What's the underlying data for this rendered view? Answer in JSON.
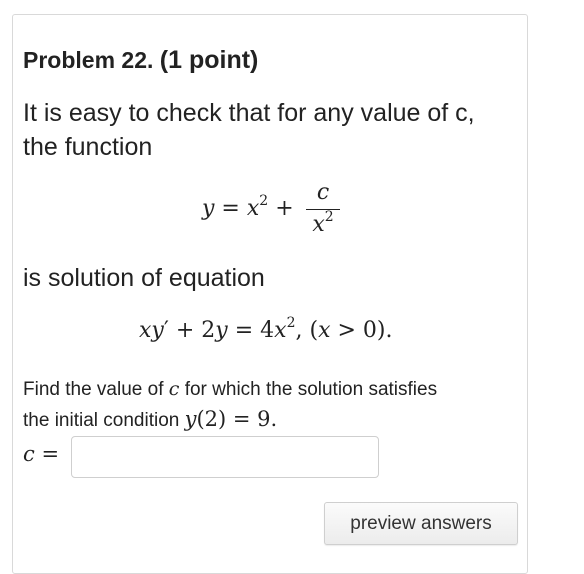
{
  "problem": {
    "label": "Problem 22.",
    "points": "(1 point)"
  },
  "intro": {
    "line1": "It is easy to check that for any value of c,",
    "line2": "the function"
  },
  "equation1": {
    "lhs": "y",
    "eq": " = ",
    "x": "x",
    "exp": "2",
    "plus": " +",
    "num": "c",
    "den_x": "x",
    "den_exp": "2"
  },
  "solution_text": "is solution of equation",
  "equation2": {
    "part1": "x",
    "part2": "y",
    "prime": "′",
    "part3": " + 2",
    "part4": "y",
    "part5": " = 4",
    "part6": "x",
    "exp": "2",
    "part7": ",  (",
    "part8": "x",
    "part9": " > 0)."
  },
  "question": {
    "line1_pre": "Find the value of ",
    "line1_var": "c",
    "line1_post": " for which the solution satisfies",
    "line2_pre": "the initial condition ",
    "line2_math_y": "y",
    "line2_math_rest": "(2) = 9."
  },
  "answer": {
    "var": "c",
    "eq": " =",
    "value": "",
    "placeholder": ""
  },
  "buttons": {
    "preview": "preview answers"
  }
}
